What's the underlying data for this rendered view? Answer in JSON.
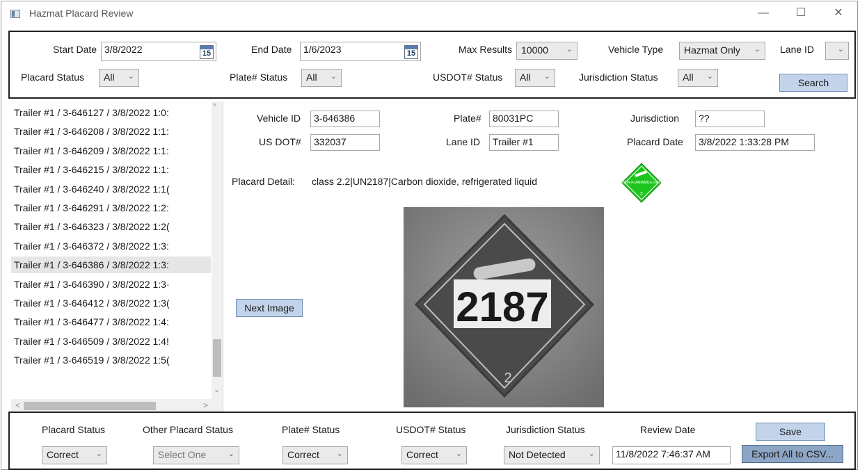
{
  "window": {
    "title": "Hazmat Placard Review",
    "controls": {
      "minimize": "—",
      "maximize": "☐",
      "close": "✕"
    }
  },
  "search": {
    "start_date_label": "Start Date",
    "start_date_value": "3/8/2022",
    "end_date_label": "End Date",
    "end_date_value": "1/6/2023",
    "calendar_day": "15",
    "max_results_label": "Max Results",
    "max_results_value": "10000",
    "vehicle_type_label": "Vehicle Type",
    "vehicle_type_value": "Hazmat Only",
    "lane_id_label": "Lane ID",
    "lane_id_value": "",
    "placard_status_label": "Placard Status",
    "placard_status_value": "All",
    "plate_status_label": "Plate# Status",
    "plate_status_value": "All",
    "usdot_status_label": "USDOT# Status",
    "usdot_status_value": "All",
    "jurisdiction_status_label": "Jurisdiction Status",
    "jurisdiction_status_value": "All",
    "search_button": "Search"
  },
  "results": {
    "items": [
      "Trailer #1 / 3-646127 / 3/8/2022 1:0:",
      "Trailer #1 / 3-646208 / 3/8/2022 1:1:",
      "Trailer #1 / 3-646209 / 3/8/2022 1:1:",
      "Trailer #1 / 3-646215 / 3/8/2022 1:1:",
      "Trailer #1 / 3-646240 / 3/8/2022 1:1(",
      "Trailer #1 / 3-646291 / 3/8/2022 1:2:",
      "Trailer #1 / 3-646323 / 3/8/2022 1:2(",
      "Trailer #1 / 3-646372 / 3/8/2022 1:3:",
      "Trailer #1 / 3-646386 / 3/8/2022 1:3:",
      "Trailer #1 / 3-646390 / 3/8/2022 1:3·",
      "Trailer #1 / 3-646412 / 3/8/2022 1:3(",
      "Trailer #1 / 3-646477 / 3/8/2022 1:4:",
      "Trailer #1 / 3-646509 / 3/8/2022 1:4!",
      "Trailer #1 / 3-646519 / 3/8/2022 1:5("
    ],
    "selected_index": 8
  },
  "detail": {
    "vehicle_id_label": "Vehicle ID",
    "vehicle_id_value": "3-646386",
    "plate_label": "Plate#",
    "plate_value": "80031PC",
    "jurisdiction_label": "Jurisdiction",
    "jurisdiction_value": "??",
    "usdot_label": "US DOT#",
    "usdot_value": "332037",
    "lane_id_label": "Lane ID",
    "lane_id_value": "Trailer #1",
    "placard_date_label": "Placard Date",
    "placard_date_value": "3/8/2022 1:33:28 PM",
    "placard_detail_label": "Placard Detail:",
    "placard_detail_value": "class 2.2|UN2187|Carbon dioxide, refrigerated liquid",
    "next_image_button": "Next Image",
    "placard_photo_un_number": "2187",
    "placard_photo_class": "2",
    "hazard_icon_text": "NON-FLAMMABLE GAS",
    "hazard_icon_class": "2",
    "hazard_icon_color": "#1ec51e"
  },
  "review": {
    "placard_status_label": "Placard Status",
    "placard_status_value": "Correct",
    "other_placard_status_label": "Other Placard Status",
    "other_placard_status_value": "Select One",
    "plate_status_label": "Plate# Status",
    "plate_status_value": "Correct",
    "usdot_status_label": "USDOT# Status",
    "usdot_status_value": "Correct",
    "jurisdiction_status_label": "Jurisdiction Status",
    "jurisdiction_status_value": "Not Detected",
    "review_date_label": "Review Date",
    "review_date_value": "11/8/2022 7:46:37 AM",
    "save_button": "Save",
    "export_button": "Export All to CSV..."
  }
}
